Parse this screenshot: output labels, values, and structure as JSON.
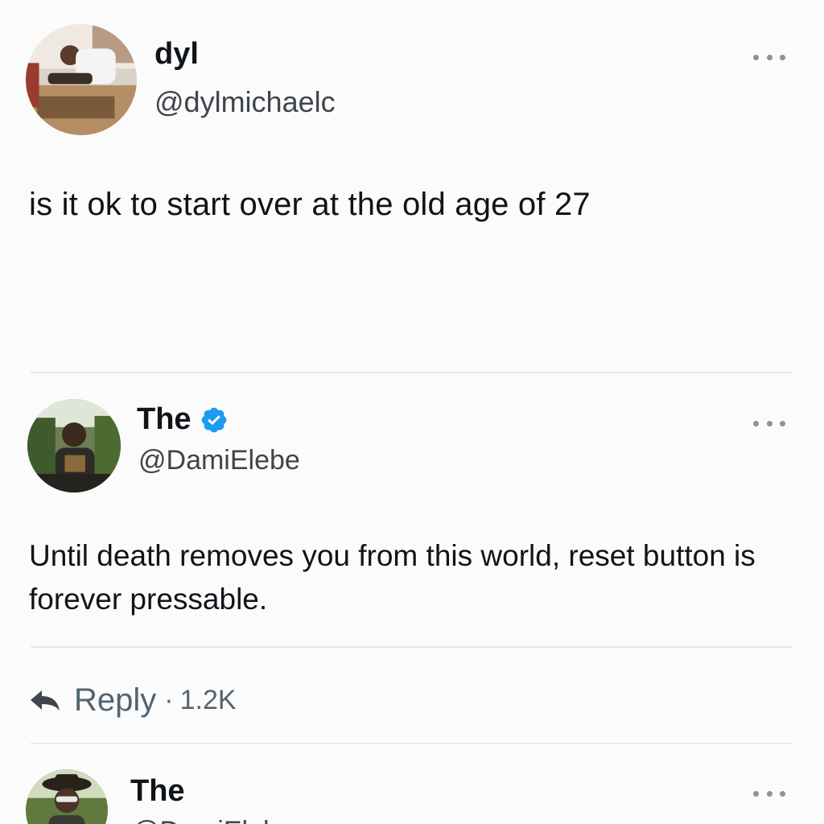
{
  "tweets": [
    {
      "name": "dyl",
      "handle": "@dylmichaelc",
      "text": "is it ok to start over at the old age of 27",
      "verified": false
    },
    {
      "name": "The",
      "handle": "@DamiElebe",
      "text": "Until death removes you from this world, reset button is forever pressable.",
      "verified": true
    },
    {
      "name": "The",
      "handle": "@DamiElebe",
      "verified": false
    }
  ],
  "reply_bar": {
    "label": "Reply",
    "separator": "·",
    "count": "1.2K"
  },
  "icons": {
    "more": "more-horizontal-icon",
    "reply": "reply-arrow-icon",
    "verified": "verified-badge-icon"
  },
  "colors": {
    "verified_blue": "#1d9bf0",
    "secondary_text": "#536471",
    "divider": "#e6e8ea"
  }
}
